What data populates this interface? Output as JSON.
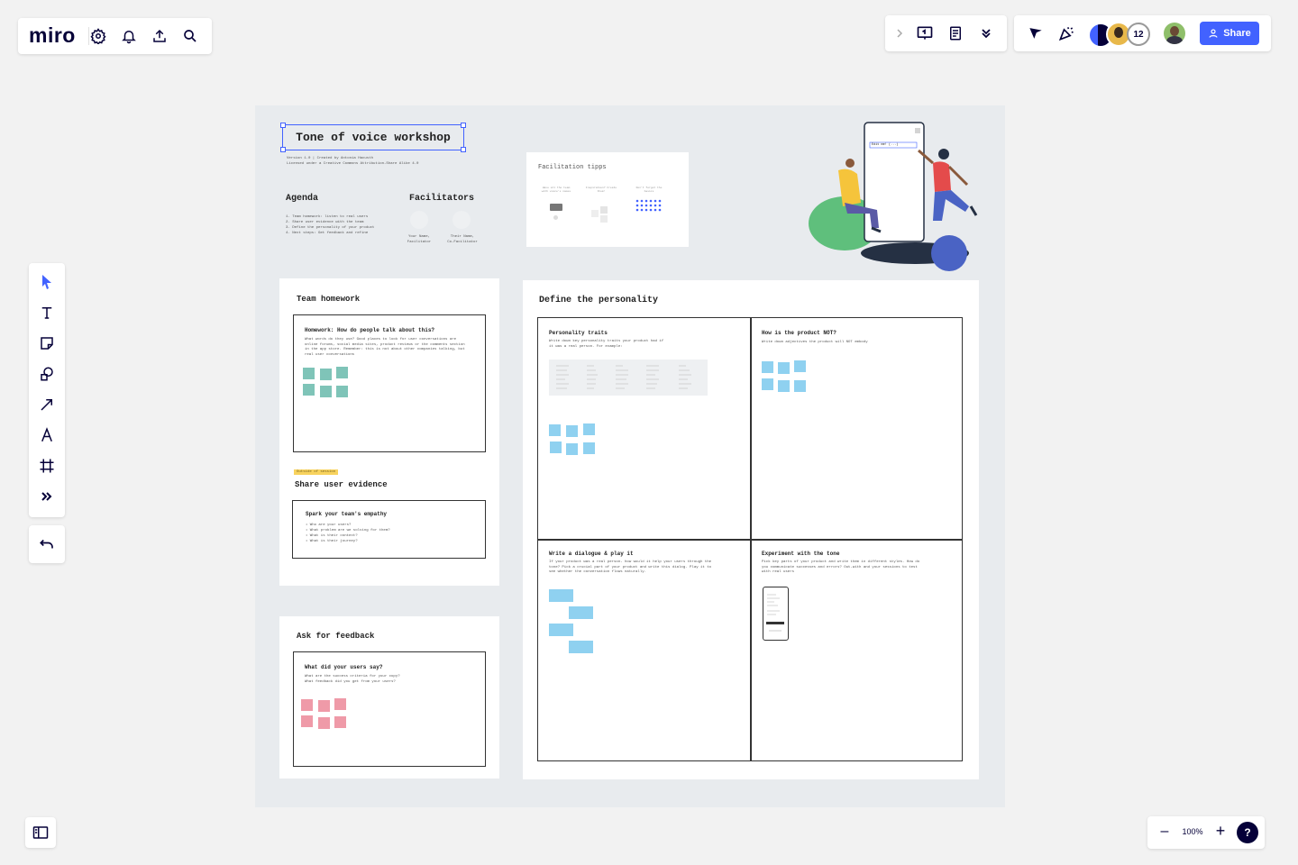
{
  "app": {
    "logo": "miro"
  },
  "toolbar_top_left": {
    "icons": [
      "gear-icon",
      "bell-icon",
      "upload-icon",
      "search-icon"
    ]
  },
  "toolbar_top_right": {
    "collab_count": "12",
    "share_label": "Share"
  },
  "zoom": {
    "value": "100%",
    "minus": "–",
    "plus": "+",
    "help": "?"
  },
  "board": {
    "title": "Tone of voice workshop",
    "version_line1": "Version 1.0 | Created by Antonia Hacusth",
    "version_line2": "Licensed under a Creative Commons Attribution-Share Alike 4.0",
    "agenda": {
      "heading": "Agenda",
      "items": [
        "1. Team homework: listen to real users",
        "2. Share user evidence with the team",
        "3. Define the personality of your product",
        "4. Next steps: Get feedback and refine"
      ]
    },
    "facilitators": {
      "heading": "Facilitators",
      "people": [
        {
          "name": "Your Name,",
          "role": "Facilitator"
        },
        {
          "name": "Their Name,",
          "role": "Co-Facilitator"
        }
      ]
    },
    "facilitation_tips": {
      "heading": "Facilitation tipps",
      "col1": "Have all the team with voice's names",
      "col2": "Inspiration? Create them!",
      "col3": "Don't forget the basics"
    },
    "illustration": {
      "phone_text": "Edit me! (...)"
    },
    "team_homework": {
      "heading": "Team homework",
      "card_title": "Homework: How do people talk about this?",
      "card_body": "What words do they use? Good places to look for user conversations are online forums, social media sites, product reviews or the comments section in the app store. Remember: this is not about other companies talking, but real user conversations"
    },
    "share_evidence": {
      "tag": "Outside of session",
      "heading": "Share user evidence",
      "card_title": "Spark your team's empathy",
      "bullets": [
        "• Who are your users?",
        "• What problem are we solving for them?",
        "• What is their context?",
        "• What is their journey?"
      ]
    },
    "feedback": {
      "heading": "Ask for feedback",
      "card_title": "What did your users say?",
      "card_body1": "What are the success criteria for your copy?",
      "card_body2": "What feedback did you get from your users?"
    },
    "personality": {
      "heading": "Define the personality",
      "q1_title": "Personality traits",
      "q1_body": "Write down key personality traits your product had if it was a real person. For example:",
      "q2_title": "How is the product NOT?",
      "q2_body": "Write down adjectives the product will NOT embody",
      "q3_title": "Write a dialogue & play it",
      "q3_body": "If your product was a real person- how would it help your users through the tone? Pick a crucial part of your product and write this dialog. Play it to see whether the conversation flows naturally.",
      "q4_title": "Experiment with the tone",
      "q4_body": "Pick key parts of your product and write them in different styles. How do you communicate successes and errors? Out-with and your sessions to test with real users"
    }
  },
  "colors": {
    "teal": "#7fc4b8",
    "blue": "#8fd1f0",
    "pink": "#ef9aa8",
    "accent": "#4262ff",
    "canvas": "#e8ebee"
  }
}
